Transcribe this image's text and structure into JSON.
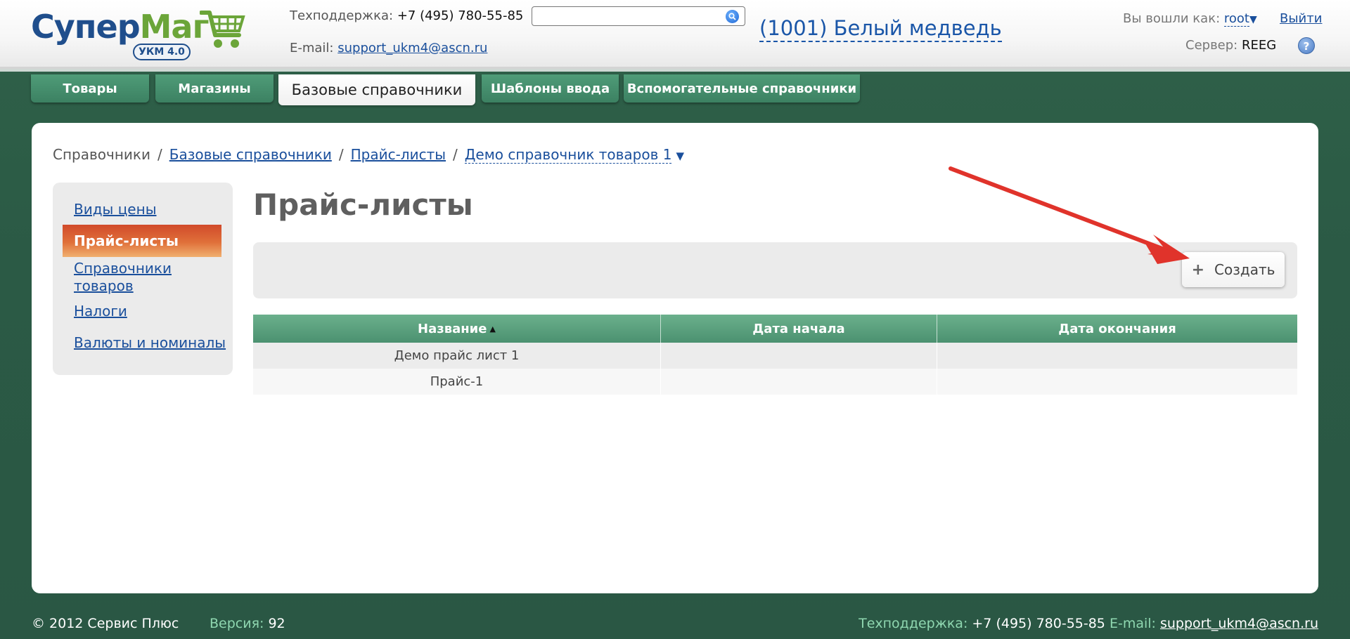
{
  "header": {
    "logo_main": "Супер",
    "logo_accent": "Маг",
    "logo_badge": "УКМ 4.0",
    "support_label": "Техподдержка:",
    "support_phone": "+7 (495) 780-55-85",
    "email_label": "E-mail:",
    "email": "support_ukm4@ascn.ru",
    "search_placeholder": "",
    "store": "(1001) Белый медведь",
    "login_label": "Вы вошли как:",
    "login_user": "root",
    "logout": "Выйти",
    "server_label": "Сервер:",
    "server_value": "REEG"
  },
  "tabs": [
    {
      "label": "Товары"
    },
    {
      "label": "Магазины"
    },
    {
      "label": "Базовые справочники",
      "active": true
    },
    {
      "label": "Шаблоны ввода"
    },
    {
      "label": "Вспомогательные справочники"
    }
  ],
  "breadcrumb": {
    "root": "Справочники",
    "level1": "Базовые справочники",
    "level2": "Прайс-листы",
    "level3": "Демо справочник товаров 1"
  },
  "sidebar": {
    "items": [
      {
        "label": "Виды цены"
      },
      {
        "label": "Прайс-листы",
        "active": true
      },
      {
        "label": "Справочники товаров"
      },
      {
        "label": "Налоги"
      },
      {
        "label": "Валюты и номиналы"
      }
    ]
  },
  "main": {
    "title": "Прайс-листы",
    "create_label": "Создать"
  },
  "table": {
    "columns": [
      "Название",
      "Дата начала",
      "Дата окончания"
    ],
    "rows": [
      [
        "Демо прайс лист 1",
        "",
        ""
      ],
      [
        "Прайс-1",
        "",
        ""
      ]
    ]
  },
  "footer": {
    "copyright": "© 2012 Сервис Плюс",
    "version_label": "Версия:",
    "version_value": "92",
    "support_label": "Техподдержка:",
    "support_phone": "+7 (495) 780-55-85",
    "email_label": "E-mail:",
    "email": "support_ukm4@ascn.ru"
  },
  "colors": {
    "background": "#2e5d48",
    "tab": "#4a9472",
    "link": "#1a4f9c",
    "active_sidebar": "#d9542f",
    "annotation_arrow": "#e0332b"
  }
}
